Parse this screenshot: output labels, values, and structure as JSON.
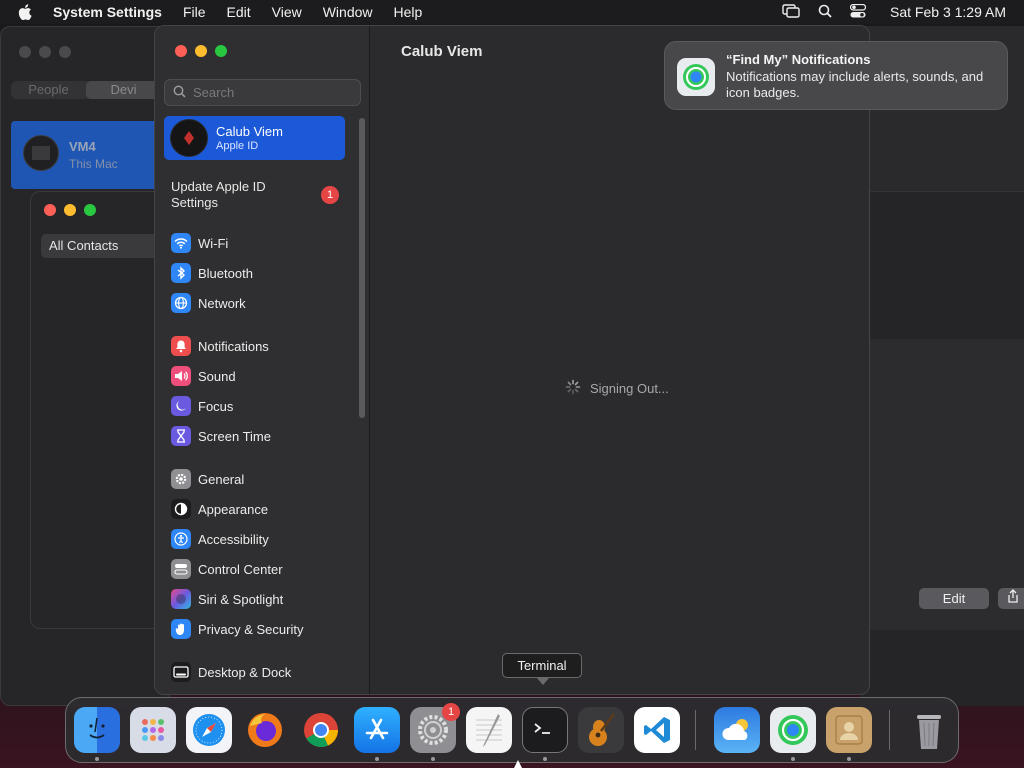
{
  "menubar": {
    "app_name": "System Settings",
    "menus": [
      "File",
      "Edit",
      "View",
      "Window",
      "Help"
    ],
    "clock": "Sat Feb 3  1:29 AM"
  },
  "background": {
    "people_tab": "People",
    "devices_tab": "Devi",
    "vm_name": "VM4",
    "vm_sub": "This Mac",
    "contacts_all": "All Contacts",
    "edit_label": "Edit"
  },
  "settings": {
    "search_placeholder": "Search",
    "account_name": "Calub Viem",
    "account_sub": "Apple ID",
    "update_label": "Update Apple ID Settings",
    "update_badge": "1",
    "content_title": "Calub Viem",
    "status_text": "Signing Out...",
    "items": [
      {
        "label": "Wi-Fi",
        "icon": "wifi-icon",
        "color": "#2f86f6"
      },
      {
        "label": "Bluetooth",
        "icon": "bluetooth-icon",
        "color": "#2f86f6"
      },
      {
        "label": "Network",
        "icon": "globe-icon",
        "color": "#2f86f6"
      },
      {
        "label": "Notifications",
        "icon": "bell-icon",
        "color": "#ef4e4e"
      },
      {
        "label": "Sound",
        "icon": "speaker-icon",
        "color": "#ef4f7a"
      },
      {
        "label": "Focus",
        "icon": "moon-icon",
        "color": "#6a5ae0"
      },
      {
        "label": "Screen Time",
        "icon": "hourglass-icon",
        "color": "#6a5ae0"
      },
      {
        "label": "General",
        "icon": "gear-icon",
        "color": "#8e8e93"
      },
      {
        "label": "Appearance",
        "icon": "appearance-icon",
        "color": "#1c1c1e"
      },
      {
        "label": "Accessibility",
        "icon": "accessibility-icon",
        "color": "#2f86f6"
      },
      {
        "label": "Control Center",
        "icon": "toggles-icon",
        "color": "#8e8e93"
      },
      {
        "label": "Siri & Spotlight",
        "icon": "siri-icon",
        "color": "#b44bd8"
      },
      {
        "label": "Privacy & Security",
        "icon": "hand-icon",
        "color": "#2f86f6"
      },
      {
        "label": "Desktop & Dock",
        "icon": "dock-icon",
        "color": "#1c1c1e"
      }
    ]
  },
  "notification": {
    "title": "“Find My” Notifications",
    "body": "Notifications may include alerts, sounds, and icon badges."
  },
  "tooltip": "Terminal",
  "dock": {
    "settings_badge": "1",
    "apps": [
      "Finder",
      "Launchpad",
      "Safari",
      "Firefox",
      "Chrome",
      "App Store",
      "System Settings",
      "TextEdit",
      "Terminal",
      "GarageBand",
      "VS Code",
      "Weather",
      "Find My",
      "Contacts",
      "Trash"
    ]
  }
}
